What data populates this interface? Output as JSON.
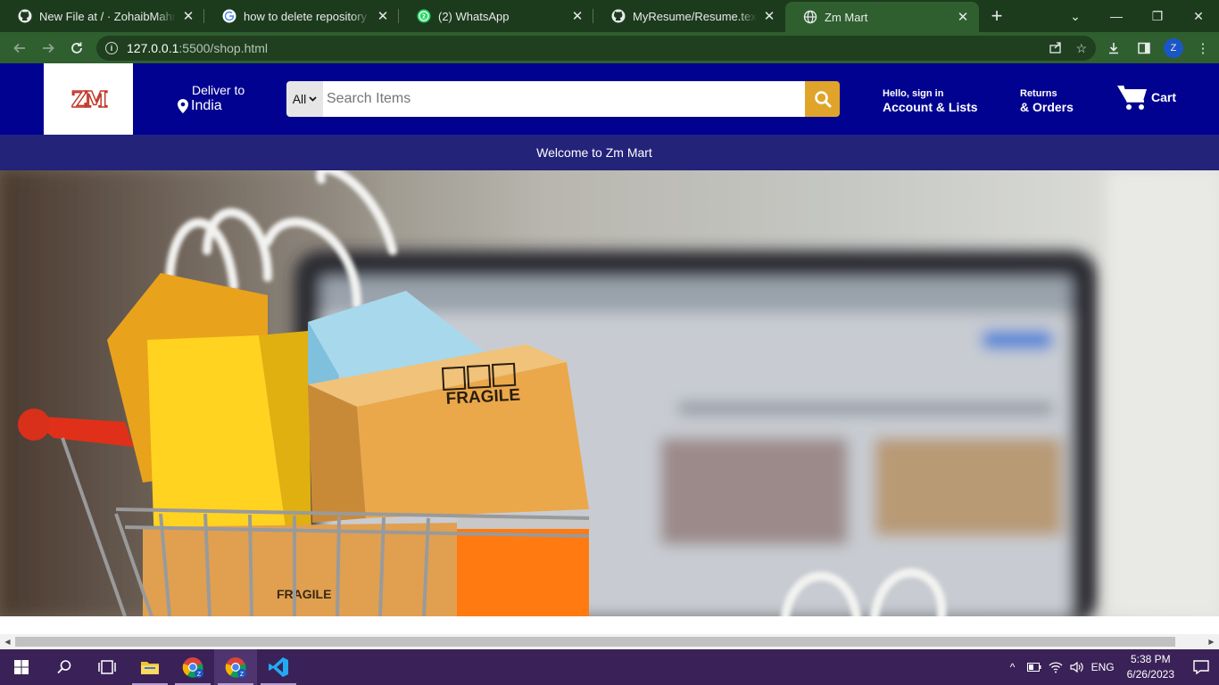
{
  "browser": {
    "tabs": [
      {
        "title": "New File at / · ZohaibMahmood",
        "icon": "github-icon"
      },
      {
        "title": "how to delete repository in git",
        "icon": "google-icon"
      },
      {
        "title": "(2) WhatsApp",
        "icon": "whatsapp-icon"
      },
      {
        "title": "MyResume/Resume.tex at main",
        "icon": "github-icon"
      },
      {
        "title": "Zm Mart",
        "icon": "globe-icon",
        "active": true
      }
    ],
    "url_host": "127.0.0.1",
    "url_path": ":5500/shop.html",
    "profile_initial": "Z"
  },
  "header": {
    "logo_text": "ZM",
    "deliver_label": "Deliver to",
    "deliver_location": "India",
    "search": {
      "category": "All",
      "placeholder": "Search Items"
    },
    "account": {
      "line1": "Hello, sign in",
      "line2": "Account & Lists"
    },
    "orders": {
      "line1": "Returns",
      "line2": "& Orders"
    },
    "cart_label": "Cart"
  },
  "welcome_text": "Welcome to Zm Mart",
  "hero": {
    "image": "shopping-cart-bags-laptop"
  },
  "taskbar": {
    "time": "5:38 PM",
    "date": "6/26/2023",
    "language": "ENG",
    "badge": "Z"
  },
  "colors": {
    "header_bg": "#020290",
    "welcome_bg": "#23237a",
    "search_button": "#e1a42a",
    "tabbar_bg": "#1c3b1c",
    "toolbar_bg": "#2f5f2f",
    "taskbar_bg": "#3a2258"
  }
}
